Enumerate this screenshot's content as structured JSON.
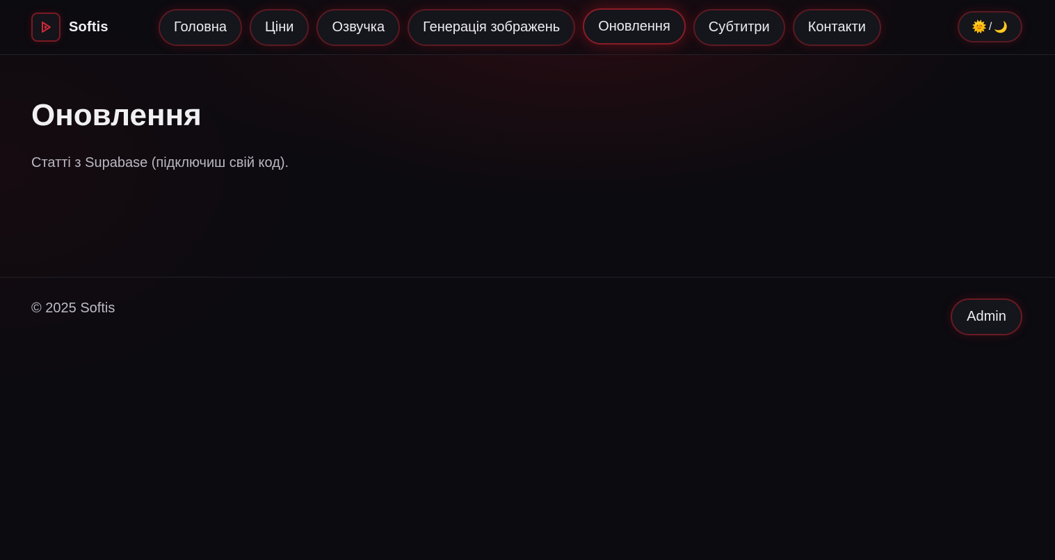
{
  "brand": {
    "name": "Softis",
    "logo_icon": "play-logo-icon",
    "accent_color": "#c0202e"
  },
  "nav": {
    "items": [
      {
        "label": "Головна",
        "active": false
      },
      {
        "label": "Ціни",
        "active": false
      },
      {
        "label": "Озвучка",
        "active": false
      },
      {
        "label": "Генерація зображень",
        "active": false
      },
      {
        "label": "Оновлення",
        "active": true
      },
      {
        "label": "Субтитри",
        "active": false
      },
      {
        "label": "Контакти",
        "active": false
      }
    ]
  },
  "theme_toggle": {
    "sun_icon": "🌞",
    "separator": "/",
    "moon_icon": "🌙"
  },
  "main": {
    "title": "Оновлення",
    "description": "Статті з Supabase (підключиш свій код)."
  },
  "footer": {
    "copyright": "© 2025 Softis",
    "admin_label": "Admin"
  }
}
